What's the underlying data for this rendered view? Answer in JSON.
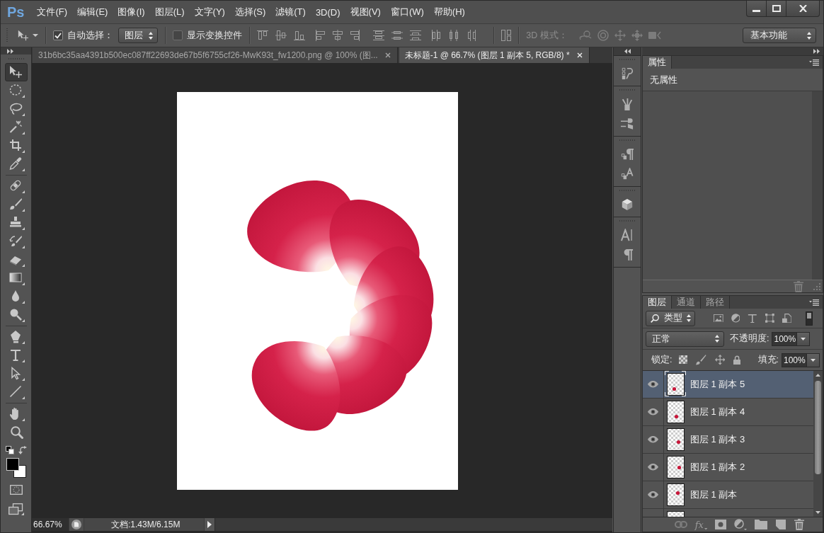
{
  "app": {
    "logo": "Ps"
  },
  "menu": [
    "文件(F)",
    "编辑(E)",
    "图像(I)",
    "图层(L)",
    "文字(Y)",
    "选择(S)",
    "滤镜(T)",
    "3D(D)",
    "视图(V)",
    "窗口(W)",
    "帮助(H)"
  ],
  "options_bar": {
    "auto_select": {
      "label": "自动选择：",
      "checked": true
    },
    "auto_select_target": "图层",
    "transform_controls": {
      "label": "显示变换控件",
      "checked": false
    },
    "mode_3d_label": "3D 模式：",
    "workspace": "基本功能"
  },
  "tabs": [
    {
      "label": "31b6bc35aa4391b500ec087ff22693de67b5f6755cf26-MwK93t_fw1200.png @ 100% (图...",
      "selected": false
    },
    {
      "label": "未标题-1 @ 66.7% (图层 1 副本 5, RGB/8) *",
      "selected": true
    }
  ],
  "tools": [
    {
      "selected": true
    },
    {
      "selected": false
    },
    {
      "selected": false
    },
    {
      "selected": false
    },
    {
      "selected": false
    },
    {
      "selected": false
    },
    {
      "selected": false
    },
    {
      "selected": false
    },
    {
      "selected": false
    },
    {
      "selected": false
    },
    {
      "selected": false
    },
    {
      "selected": false
    },
    {
      "selected": false
    },
    {
      "selected": false
    },
    {
      "selected": false
    },
    {
      "selected": false
    },
    {
      "selected": false
    },
    {
      "selected": false
    },
    {
      "selected": false
    },
    {
      "selected": false
    }
  ],
  "colors": {
    "foreground": {
      "color": "#000000"
    },
    "background": {
      "color": "#ffffff"
    }
  },
  "status_bar": {
    "zoom": "66.67%",
    "document_info": "文档:1.43M/6.15M"
  },
  "properties_panel": {
    "tabs": [
      {
        "label": "属性",
        "selected": true
      }
    ],
    "message": "无属性"
  },
  "layers_panel": {
    "tabs": [
      {
        "label": "图层",
        "selected": true
      },
      {
        "label": "通道",
        "selected": false
      },
      {
        "label": "路径",
        "selected": false
      }
    ],
    "filter": "类型",
    "filter_enabled": true,
    "blend_mode": "正常",
    "opacity": {
      "label": "不透明度:",
      "value": "100%"
    },
    "lock_label": "锁定:",
    "fill": {
      "label": "填充:",
      "value": "100%"
    },
    "layers": [
      {
        "name": "图层 1 副本 5",
        "visible": true,
        "selected": true
      },
      {
        "name": "图层 1 副本 4",
        "visible": true,
        "selected": false
      },
      {
        "name": "图层 1 副本 3",
        "visible": true,
        "selected": false
      },
      {
        "name": "图层 1 副本 2",
        "visible": true,
        "selected": false
      },
      {
        "name": "图层 1 副本",
        "visible": true,
        "selected": false
      },
      {
        "selected": false
      }
    ],
    "effects_button": "fx"
  }
}
